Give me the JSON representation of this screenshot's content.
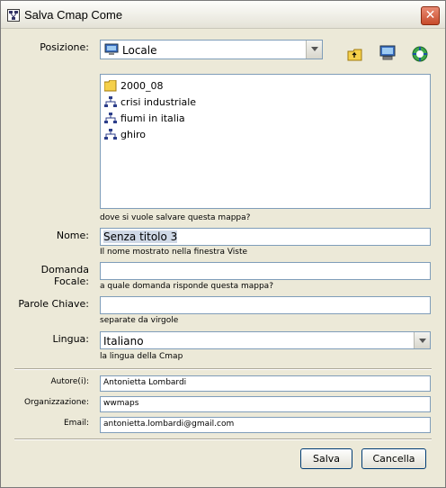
{
  "window": {
    "title": "Salva Cmap Come"
  },
  "location": {
    "label": "Posizione:",
    "selected": "Locale",
    "items": [
      "2000_08",
      "crisi industriale",
      "fiumi in italia",
      "ghiro"
    ],
    "hint": "dove si vuole salvare questa mappa?"
  },
  "name": {
    "label": "Nome:",
    "value": "Senza titolo 3",
    "hint": "Il nome mostrato nella finestra Viste"
  },
  "focus_question": {
    "label": "Domanda Focale:",
    "value": "",
    "hint": "a quale domanda risponde questa mappa?"
  },
  "keywords": {
    "label": "Parole Chiave:",
    "value": "",
    "hint": "separate da virgole"
  },
  "language": {
    "label": "Lingua:",
    "value": "Italiano",
    "hint": "la lingua della Cmap"
  },
  "author": {
    "label": "Autore(i):",
    "value": "Antonietta Lombardi"
  },
  "organization": {
    "label": "Organizzazione:",
    "value": "wwmaps"
  },
  "email": {
    "label": "Email:",
    "value": "antonietta.lombardi@gmail.com"
  },
  "buttons": {
    "save": "Salva",
    "cancel": "Cancella"
  }
}
